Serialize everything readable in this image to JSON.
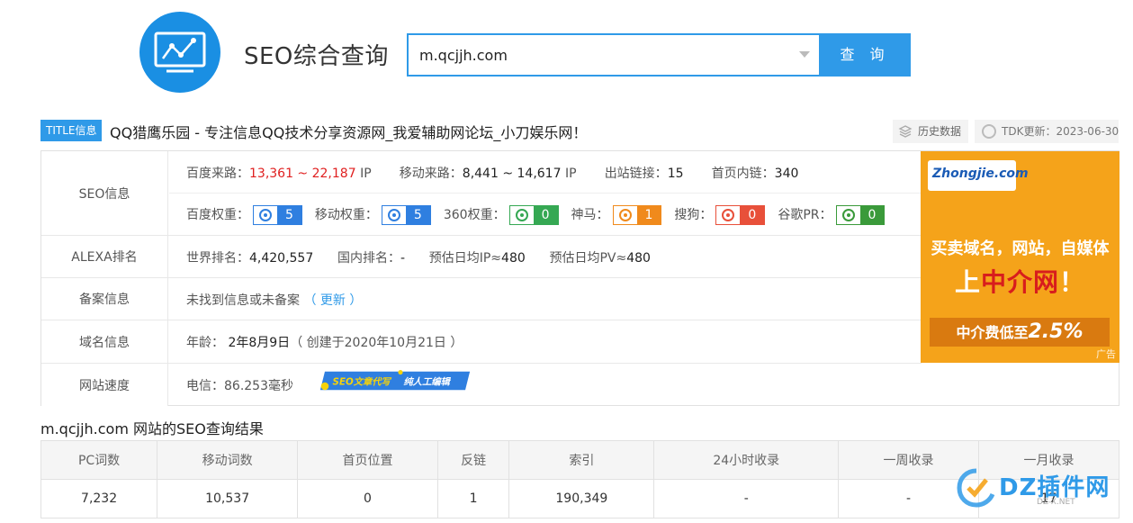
{
  "header": {
    "site_title": "SEO综合查询",
    "search_value": "m.qcjjh.com",
    "search_button": "查 询"
  },
  "title_row": {
    "badge": "TITLE信息",
    "title": "QQ猎鹰乐园 - 专注信息QQ技术分享资源网_我爱辅助网论坛_小刀娱乐网！",
    "history_button": "历史数据",
    "tdk_update": "TDK更新：2023-06-30"
  },
  "seo_info": {
    "label": "SEO信息",
    "baidu_traffic_label": "百度来路：",
    "baidu_traffic": "13,361 ~ 22,187",
    "baidu_traffic_unit": "IP",
    "mobile_traffic_label": "移动来路：",
    "mobile_traffic": "8,441 ~ 14,617",
    "mobile_traffic_unit": "IP",
    "outbound_label": "出站链接：",
    "outbound": "15",
    "inbound_label": "首页内链：",
    "inbound": "340",
    "ranks": [
      {
        "label": "百度权重：",
        "value": "5",
        "color": "#2f7fe0",
        "icon": "paw-icon"
      },
      {
        "label": "移动权重：",
        "value": "5",
        "color": "#2f7fe0",
        "icon": "paw-icon"
      },
      {
        "label": "360权重：",
        "value": "0",
        "color": "#35a853",
        "icon": "360-icon"
      },
      {
        "label": "神马：",
        "value": "1",
        "color": "#f08a1c",
        "icon": "shenma-icon"
      },
      {
        "label": "搜狗：",
        "value": "0",
        "color": "#e8503a",
        "icon": "sogou-icon"
      },
      {
        "label": "谷歌PR：",
        "value": "0",
        "color": "#3a9a3a",
        "icon": "google-plus-icon"
      }
    ]
  },
  "alexa": {
    "label": "ALEXA排名",
    "world_label": "世界排名：",
    "world": "4,420,557",
    "domestic_label": "国内排名：",
    "domestic": "-",
    "ip_label": "预估日均IP≈",
    "ip": "480",
    "pv_label": "预估日均PV≈",
    "pv": "480"
  },
  "icp": {
    "label": "备案信息",
    "text": "未找到信息或未备案",
    "update_link": "（ 更新 ）"
  },
  "domain": {
    "label": "域名信息",
    "age_label": "年龄：",
    "age": "2年8月9日",
    "created": "（ 创建于2020年10月21日 ）"
  },
  "speed": {
    "label": "网站速度",
    "text": "电信：86.253毫秒",
    "banner_a": "SEO文章代写",
    "banner_b": "纯人工编辑"
  },
  "ad": {
    "logo": "Zhongjie.com",
    "line1": "买卖域名，网站，自媒体",
    "line2_a": "上",
    "line2_b": "中介网",
    "line2_c": "！",
    "line3_a": "中介费低至",
    "line3_b": "2.5%",
    "tag": "广告"
  },
  "results": {
    "title": "m.qcjjh.com 网站的SEO查询结果",
    "headers": [
      "PC词数",
      "移动词数",
      "首页位置",
      "反链",
      "索引",
      "24小时收录",
      "一周收录",
      "一月收录"
    ],
    "values": [
      "7,232",
      "10,537",
      "0",
      "1",
      "190,349",
      "-",
      "-",
      "17"
    ]
  },
  "watermark": {
    "text": "DZ插件网",
    "sub": "DZ-X.NET"
  }
}
